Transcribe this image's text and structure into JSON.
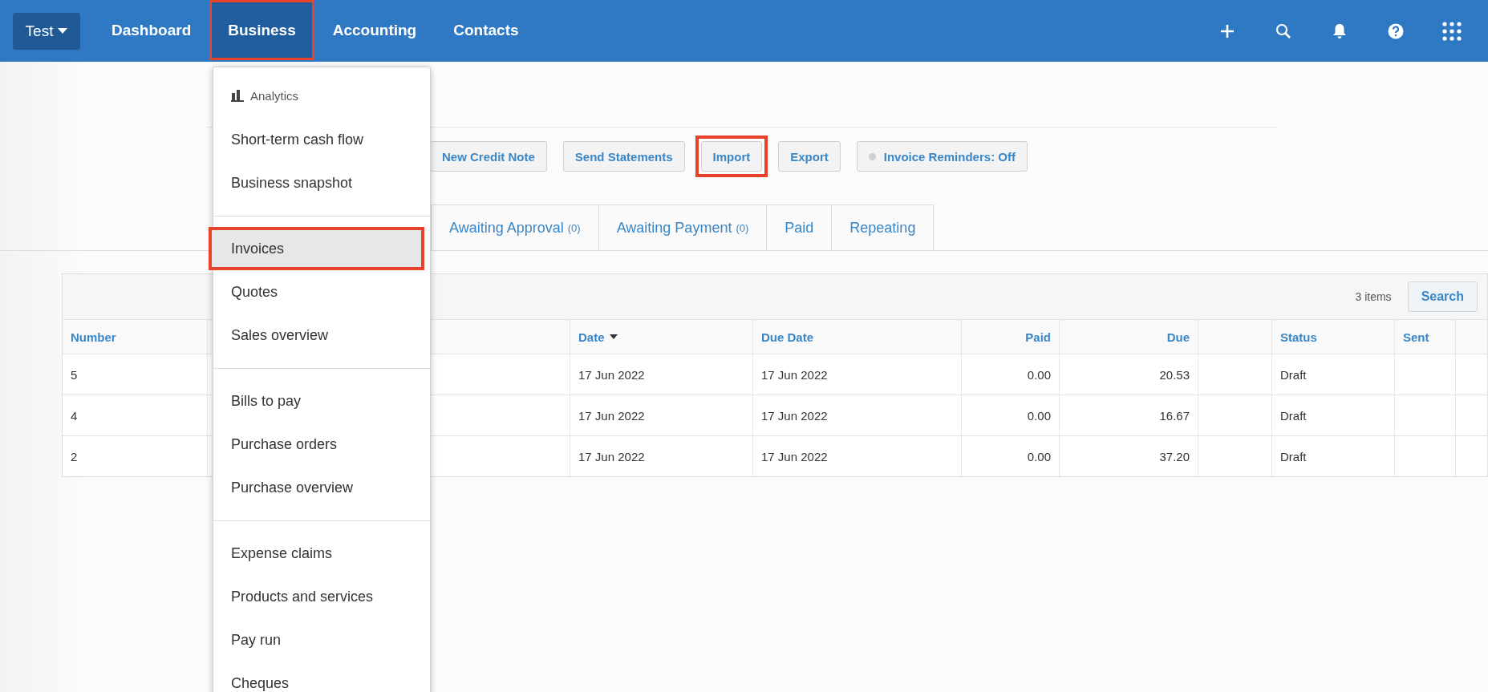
{
  "org_button": {
    "label": "Test"
  },
  "nav": [
    {
      "label": "Dashboard",
      "selected": false,
      "annotated": false
    },
    {
      "label": "Business",
      "selected": true,
      "annotated": true
    },
    {
      "label": "Accounting",
      "selected": false,
      "annotated": false
    },
    {
      "label": "Contacts",
      "selected": false,
      "annotated": false
    }
  ],
  "toolbar": [
    {
      "label": "New Credit Note",
      "kind": "button",
      "annotated": false
    },
    {
      "label": "Send Statements",
      "kind": "button",
      "annotated": false
    },
    {
      "label": "Import",
      "kind": "button",
      "annotated": true
    },
    {
      "label": "Export",
      "kind": "button",
      "annotated": false
    },
    {
      "label": "Invoice Reminders: Off",
      "kind": "toggle",
      "on": false,
      "annotated": false
    }
  ],
  "tabs": [
    {
      "label": "Awaiting Approval",
      "count": "(0)",
      "selected": false
    },
    {
      "label": "Awaiting Payment",
      "count": "(0)",
      "selected": false
    },
    {
      "label": "Paid",
      "selected": false
    },
    {
      "label": "Repeating",
      "selected": false
    }
  ],
  "table": {
    "count": "3 items",
    "search_button": "Search",
    "columns": [
      {
        "label": "Number",
        "sorted": false
      },
      {
        "label": "Date",
        "sorted": true
      },
      {
        "label": "Due Date",
        "sorted": false
      },
      {
        "label": "Paid",
        "sorted": false
      },
      {
        "label": "Due",
        "sorted": false
      },
      {
        "label": "Status",
        "sorted": false
      },
      {
        "label": "Sent",
        "sorted": false
      }
    ],
    "rows": [
      {
        "cells": [
          "5",
          "17 Jun 2022",
          "17 Jun 2022",
          "0.00",
          "20.53",
          "Draft"
        ]
      },
      {
        "cells": [
          "4",
          "17 Jun 2022",
          "17 Jun 2022",
          "0.00",
          "16.67",
          "Draft"
        ]
      },
      {
        "cells": [
          "2",
          "17 Jun 2022",
          "17 Jun 2022",
          "0.00",
          "37.20",
          "Draft"
        ]
      }
    ]
  },
  "menu": {
    "header": "Analytics",
    "sections": [
      [
        {
          "label": "Short-term cash flow",
          "selected": false,
          "annotated": false
        },
        {
          "label": "Business snapshot",
          "selected": false,
          "annotated": false
        }
      ],
      [
        {
          "label": "Invoices",
          "selected": true,
          "annotated": true
        },
        {
          "label": "Quotes",
          "selected": false,
          "annotated": false
        },
        {
          "label": "Sales overview",
          "selected": false,
          "annotated": false
        }
      ],
      [
        {
          "label": "Bills to pay",
          "selected": false,
          "annotated": false
        },
        {
          "label": "Purchase orders",
          "selected": false,
          "annotated": false
        },
        {
          "label": "Purchase overview",
          "selected": false,
          "annotated": false
        }
      ],
      [
        {
          "label": "Expense claims",
          "selected": false,
          "annotated": false
        },
        {
          "label": "Products and services",
          "selected": false,
          "annotated": false
        },
        {
          "label": "Pay run",
          "selected": false,
          "annotated": false
        },
        {
          "label": "Cheques",
          "selected": false,
          "annotated": false
        }
      ]
    ]
  }
}
